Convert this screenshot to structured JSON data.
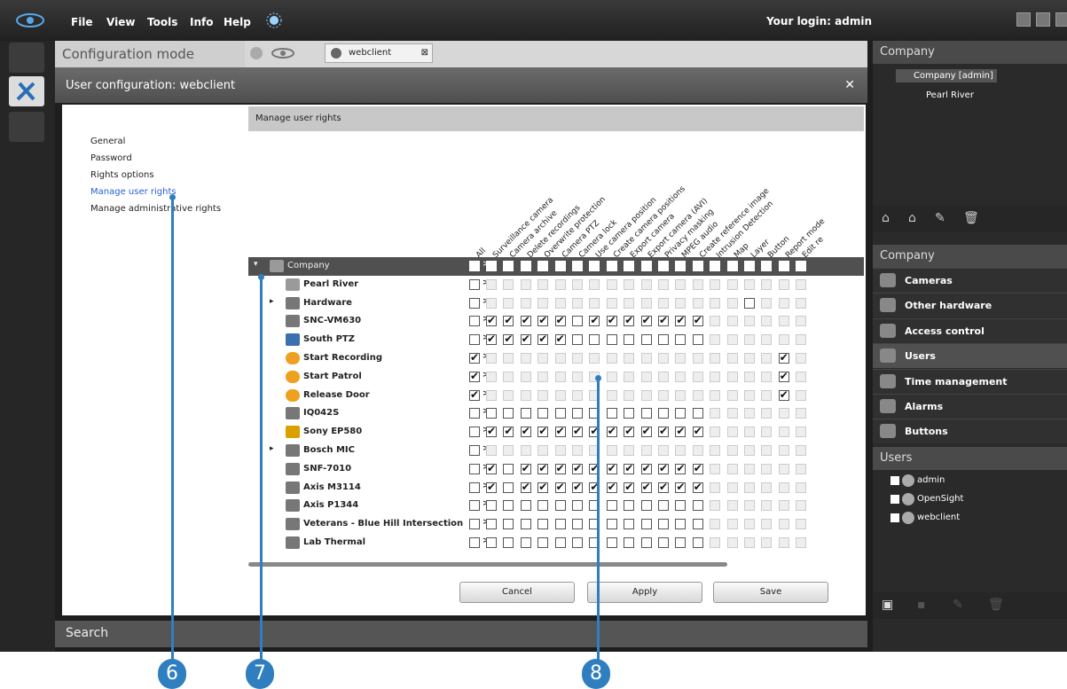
{
  "menu": {
    "file": "File",
    "view": "View",
    "tools": "Tools",
    "info": "Info",
    "help": "Help",
    "login": "Your login: admin"
  },
  "config_title": "Configuration mode",
  "tab_label": "webclient",
  "dialog_title": "User configuration: webclient",
  "nav": {
    "general": "General",
    "password": "Password",
    "rights_options": "Rights options",
    "manage_user_rights": "Manage user rights",
    "manage_admin_rights": "Manage administrative rights"
  },
  "rights": {
    "header": "Manage user rights",
    "columns": [
      "All",
      "Surveillance camera",
      "Camera archive",
      "Delete recordings",
      "Overwrite protection",
      "Camera PTZ",
      "Camera lock",
      "Use camera position",
      "Create camera positions",
      "Export camera",
      "Export camera (AVI)",
      "Privacy masking",
      "MPEG audio",
      "Create reference image",
      "Intrusion Detection",
      "Map",
      "Layer",
      "Button",
      "Report mode",
      "Edit re"
    ],
    "rows": [
      {
        "name": "Company",
        "type": "company"
      },
      {
        "name": "Pearl River",
        "type": "site"
      },
      {
        "name": "Hardware",
        "type": "hardware"
      },
      {
        "name": "SNC-VM630",
        "type": "camera"
      },
      {
        "name": "South PTZ",
        "type": "ptz"
      },
      {
        "name": "Start Recording",
        "type": "button"
      },
      {
        "name": "Start Patrol",
        "type": "button"
      },
      {
        "name": "Release Door",
        "type": "button"
      },
      {
        "name": "IQ042S",
        "type": "camera"
      },
      {
        "name": "Sony EP580",
        "type": "camera-warn"
      },
      {
        "name": "Bosch MIC",
        "type": "hardware"
      },
      {
        "name": "SNF-7010",
        "type": "camera"
      },
      {
        "name": "Axis M3114",
        "type": "camera"
      },
      {
        "name": "Axis P1344",
        "type": "camera"
      },
      {
        "name": "Veterans - Blue Hill Intersection",
        "type": "camera"
      },
      {
        "name": "Lab Thermal",
        "type": "camera"
      }
    ],
    "cancel": "Cancel",
    "apply": "Apply",
    "save": "Save",
    "expand_glyph": ">>"
  },
  "search_label": "Search",
  "right_panel": {
    "tree_title": "Company",
    "tree_items": [
      "Company [admin]",
      "Pearl River"
    ],
    "menu_title": "Company",
    "menu_items": [
      "Cameras",
      "Other hardware",
      "Access control",
      "Users",
      "Time management",
      "Alarms",
      "Buttons"
    ],
    "users_title": "Users",
    "users": [
      "admin",
      "OpenSight",
      "webclient"
    ]
  },
  "callouts": [
    "6",
    "7",
    "8"
  ],
  "colors": {
    "accent_blue": "#2f7fc0",
    "link_blue": "#2a5fd6",
    "header_dark": "#505050"
  }
}
